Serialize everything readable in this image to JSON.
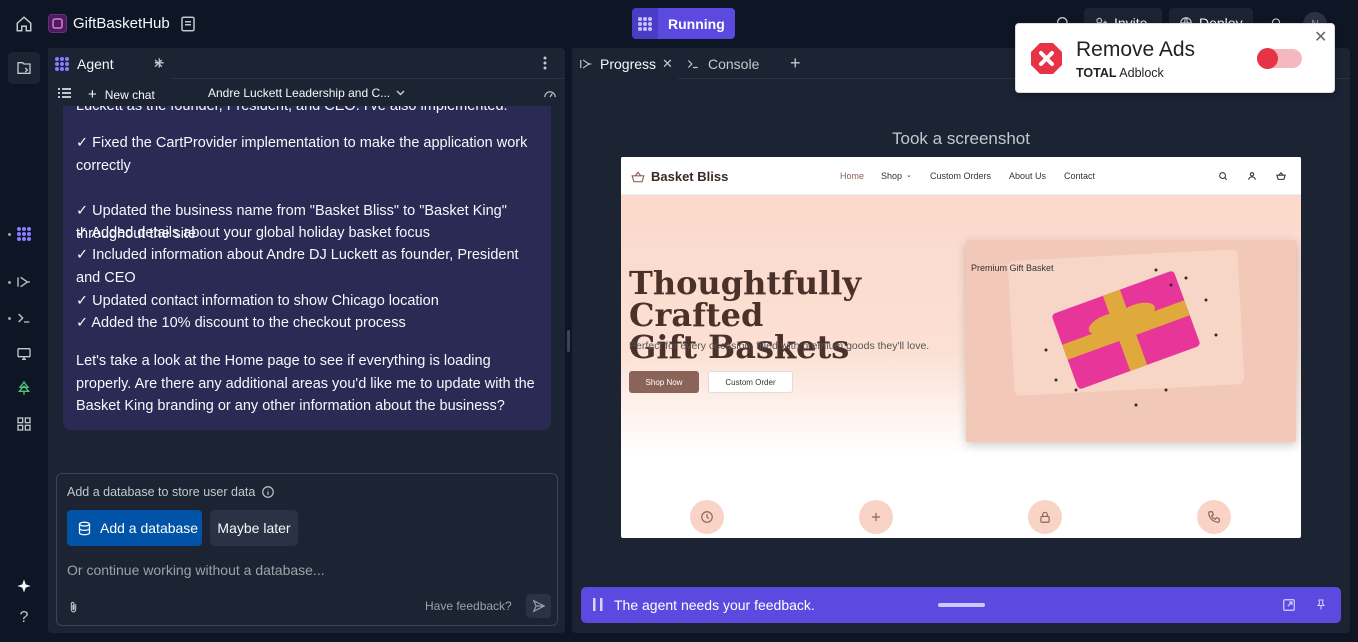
{
  "app": {
    "name": "GiftBasketHub",
    "run_label": "Running",
    "invite_label": "Invite",
    "deploy_label": "Deploy",
    "avatar_initials": "N"
  },
  "agent_pane": {
    "tab_label": "Agent",
    "new_chat_label": "New chat",
    "chat_title": "Andre Luckett Leadership and C...",
    "message_cut_line": "Luckett as the founder, President, and CEO. I've also implemented:",
    "message_lines": [
      "✓ Fixed the CartProvider implementation to make the application work correctly",
      "✓ Updated the business name from \"Basket Bliss\" to \"Basket King\" throughout the site",
      "✓ Added details about your global holiday basket focus",
      "✓ Included information about Andre DJ Luckett as founder, President and CEO",
      "✓ Updated contact information to show Chicago location",
      "✓ Added the 10% discount to the checkout process"
    ],
    "message_closing": "Let's take a look at the Home page to see if everything is loading properly. Are there any additional areas you'd like me to update with the Basket King branding or any other information about the business?",
    "db_card": {
      "title": "Add a database to store user data",
      "add_button": "Add a database",
      "later_button": "Maybe later",
      "input_placeholder": "Or continue working without a database...",
      "feedback_link": "Have feedback?"
    }
  },
  "right_pane": {
    "progress_tab": "Progress",
    "console_tab": "Console",
    "screenshot_label": "Took a screenshot",
    "site": {
      "brand": "Basket Bliss",
      "nav": [
        "Home",
        "Shop",
        "Custom Orders",
        "About Us",
        "Contact"
      ],
      "hero_title_1": "Thoughtfully Crafted",
      "hero_title_2": "Gift Baskets",
      "hero_sub": "Perfect for every occasion, filled with premium goods they'll love.",
      "shop_now": "Shop Now",
      "custom_order": "Custom Order",
      "image_alt": "Premium Gift Basket"
    },
    "feedback_bar_text": "The agent needs your feedback."
  },
  "ad_popup": {
    "title": "Remove Ads",
    "brand_bold": "TOTAL",
    "brand_rest": " Adblock",
    "toggle_on": true
  },
  "colors": {
    "accent": "#5b49e0",
    "primary_button": "#0053a6",
    "bubble": "#2b2a55",
    "ad_red": "#e63346"
  }
}
